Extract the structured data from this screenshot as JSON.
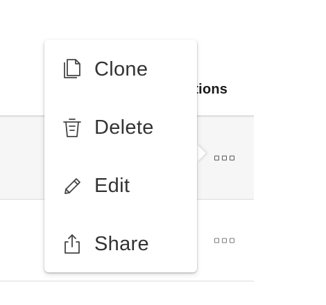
{
  "table": {
    "column_header": "ctions",
    "rows": [
      {
        "actions_icon": "more-options-icon"
      },
      {
        "actions_icon": "more-options-icon"
      }
    ]
  },
  "menu": {
    "items": [
      {
        "label": "Clone",
        "icon": "clone-icon"
      },
      {
        "label": "Delete",
        "icon": "trash-icon"
      },
      {
        "label": "Edit",
        "icon": "pencil-icon"
      },
      {
        "label": "Share",
        "icon": "share-icon"
      }
    ]
  },
  "colors": {
    "row_highlight": "#f6f6f6",
    "border": "#dcdcdc",
    "text": "#333333"
  }
}
